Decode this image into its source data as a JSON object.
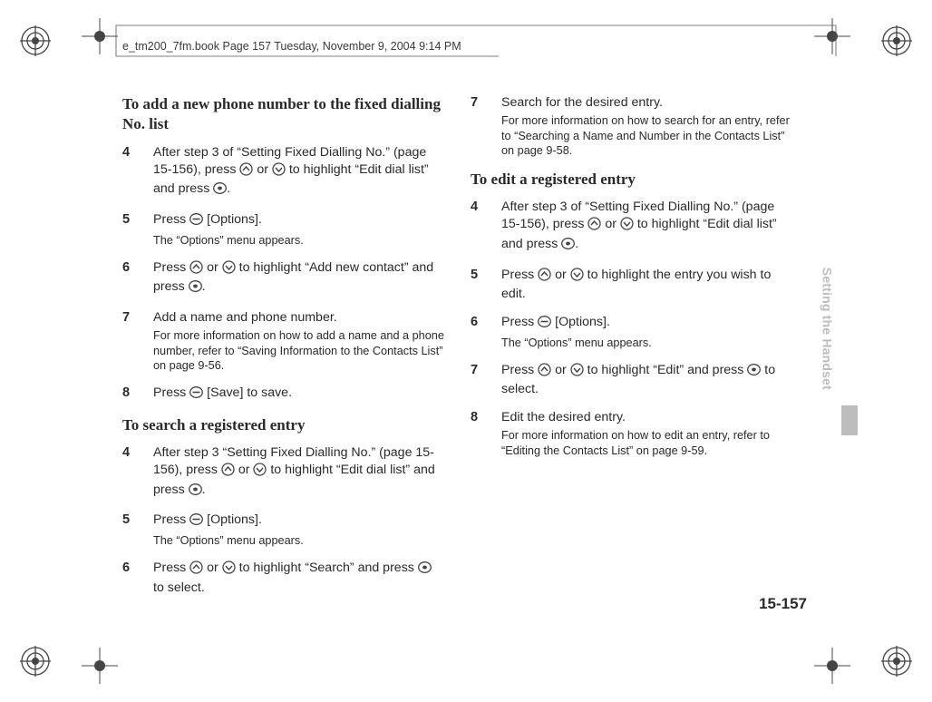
{
  "header": "e_tm200_7fm.book  Page 157  Tuesday, November 9, 2004  9:14 PM",
  "page_number": "15-157",
  "side_tab": "Setting the Handset",
  "col1": {
    "h1": "To add a new phone number to the fixed dialling No. list",
    "s4": {
      "num": "4",
      "pre": "After step 3 of “Setting Fixed Dialling No.” (page 15-156), press ",
      "mid": " or ",
      "post1": " to highlight “Edit dial list” and press ",
      "post2": "."
    },
    "s5": {
      "num": "5",
      "pre": "Press ",
      "post": " [Options].",
      "sub": "The “Options” menu appears."
    },
    "s6": {
      "num": "6",
      "pre": "Press ",
      "mid": " or ",
      "post1": " to highlight “Add new contact” and press ",
      "post2": "."
    },
    "s7": {
      "num": "7",
      "main": "Add a name and phone number.",
      "sub": "For more information on how to add a name and a phone number, refer to “Saving Information to the Contacts List” on page 9-56."
    },
    "s8": {
      "num": "8",
      "pre": "Press ",
      "post": " [Save] to save."
    },
    "h2": "To search a registered entry",
    "s4b": {
      "num": "4",
      "pre": "After step 3 “Setting Fixed Dialling No.” (page 15-156), press ",
      "mid": " or ",
      "post1": " to highlight “Edit dial list” and press ",
      "post2": "."
    },
    "s5b": {
      "num": "5",
      "pre": "Press ",
      "post": " [Options].",
      "sub": "The “Options” menu appears."
    },
    "s6b": {
      "num": "6",
      "pre": "Press ",
      "mid": " or ",
      "post1": " to highlight “Search” and press ",
      "post2": " to select."
    }
  },
  "col2": {
    "s7": {
      "num": "7",
      "main": "Search for the desired entry.",
      "sub": "For more information on how to search for an entry, refer to “Searching a Name and Number in the Contacts List” on page 9-58."
    },
    "h1": "To edit a registered entry",
    "s4": {
      "num": "4",
      "pre": "After step 3 of “Setting Fixed Dialling No.” (page 15-156), press ",
      "mid": " or ",
      "post1": " to highlight “Edit dial list” and press ",
      "post2": "."
    },
    "s5": {
      "num": "5",
      "pre": "Press ",
      "mid": " or ",
      "post": " to highlight the entry you wish to edit."
    },
    "s6": {
      "num": "6",
      "pre": "Press ",
      "post": " [Options].",
      "sub": "The “Options” menu appears."
    },
    "s7b": {
      "num": "7",
      "pre": "Press ",
      "mid": " or ",
      "post1": " to highlight “Edit” and press ",
      "post2": " to select."
    },
    "s8": {
      "num": "8",
      "main": "Edit the desired entry.",
      "sub": "For more information on how to edit an entry, refer to “Editing the Contacts List” on page 9-59."
    }
  }
}
